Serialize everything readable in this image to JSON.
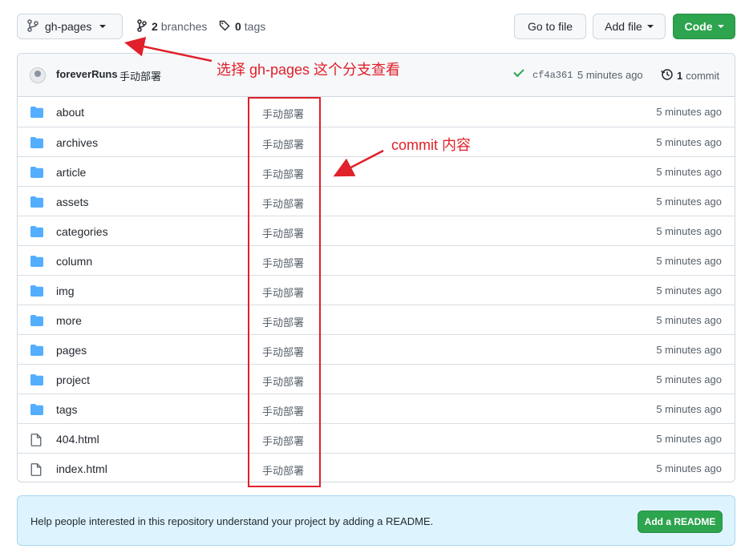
{
  "toolbar": {
    "branch": "gh-pages",
    "branches_count": "2",
    "branches_label": "branches",
    "tags_count": "0",
    "tags_label": "tags",
    "goto_file": "Go to file",
    "add_file": "Add file",
    "code": "Code"
  },
  "latest_commit": {
    "author": "foreverRuns",
    "message": "手动部署",
    "sha": "cf4a361",
    "time": "5 minutes ago",
    "commits_count": "1",
    "commits_label": "commit"
  },
  "files": [
    {
      "name": "about",
      "type": "folder",
      "message": "手动部署",
      "time": "5 minutes ago"
    },
    {
      "name": "archives",
      "type": "folder",
      "message": "手动部署",
      "time": "5 minutes ago"
    },
    {
      "name": "article",
      "type": "folder",
      "message": "手动部署",
      "time": "5 minutes ago"
    },
    {
      "name": "assets",
      "type": "folder",
      "message": "手动部署",
      "time": "5 minutes ago"
    },
    {
      "name": "categories",
      "type": "folder",
      "message": "手动部署",
      "time": "5 minutes ago"
    },
    {
      "name": "column",
      "type": "folder",
      "message": "手动部署",
      "time": "5 minutes ago"
    },
    {
      "name": "img",
      "type": "folder",
      "message": "手动部署",
      "time": "5 minutes ago"
    },
    {
      "name": "more",
      "type": "folder",
      "message": "手动部署",
      "time": "5 minutes ago"
    },
    {
      "name": "pages",
      "type": "folder",
      "message": "手动部署",
      "time": "5 minutes ago"
    },
    {
      "name": "project",
      "type": "folder",
      "message": "手动部署",
      "time": "5 minutes ago"
    },
    {
      "name": "tags",
      "type": "folder",
      "message": "手动部署",
      "time": "5 minutes ago"
    },
    {
      "name": "404.html",
      "type": "file",
      "message": "手动部署",
      "time": "5 minutes ago"
    },
    {
      "name": "index.html",
      "type": "file",
      "message": "手动部署",
      "time": "5 minutes ago"
    }
  ],
  "readme_banner": {
    "text": "Help people interested in this repository understand your project by adding a README.",
    "button": "Add a README"
  },
  "annotations": {
    "branch_note": "选择 gh-pages 这个分支查看",
    "commit_note": "commit 内容"
  },
  "colors": {
    "accent_green": "#2da44e",
    "annotation_red": "#e0202a",
    "folder_blue": "#54aeff"
  }
}
